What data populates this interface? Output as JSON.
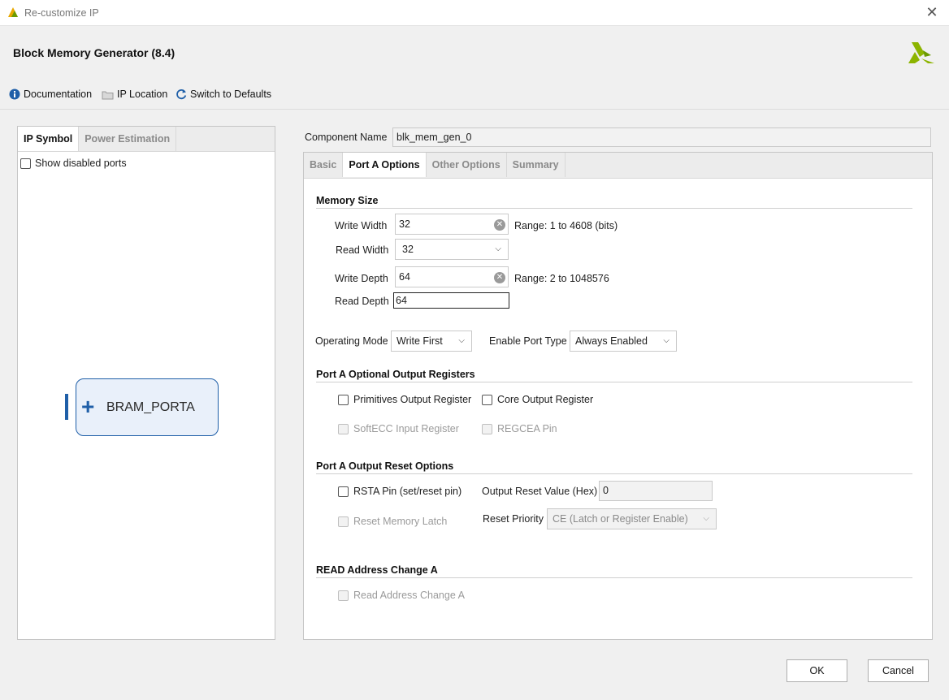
{
  "window": {
    "title": "Re-customize IP"
  },
  "header": {
    "title": "Block Memory Generator (8.4)"
  },
  "toolbar": {
    "documentation": "Documentation",
    "ip_location": "IP Location",
    "switch_defaults": "Switch to Defaults"
  },
  "left_panel": {
    "tabs": [
      "IP Symbol",
      "Power Estimation"
    ],
    "show_disabled_ports": "Show disabled ports",
    "port_label": "BRAM_PORTA"
  },
  "component": {
    "label": "Component Name",
    "value": "blk_mem_gen_0"
  },
  "tabs": [
    "Basic",
    "Port A Options",
    "Other Options",
    "Summary"
  ],
  "memory_size": {
    "title": "Memory Size",
    "write_width_label": "Write Width",
    "write_width": "32",
    "write_width_range": "Range: 1 to 4608 (bits)",
    "read_width_label": "Read Width",
    "read_width": "32",
    "write_depth_label": "Write Depth",
    "write_depth": "64",
    "write_depth_range": "Range: 2 to 1048576",
    "read_depth_label": "Read Depth",
    "read_depth": "64"
  },
  "operating_mode": {
    "label": "Operating Mode",
    "value": "Write First"
  },
  "enable_port": {
    "label": "Enable Port Type",
    "value": "Always Enabled"
  },
  "output_registers": {
    "title": "Port A Optional Output Registers",
    "primitives": "Primitives Output Register",
    "core": "Core Output Register",
    "softecc": "SoftECC Input Register",
    "regcea": "REGCEA Pin"
  },
  "reset_options": {
    "title": "Port A Output Reset Options",
    "rsta": "RSTA Pin (set/reset pin)",
    "output_reset_label": "Output Reset Value (Hex)",
    "output_reset_value": "0",
    "reset_memory_latch": "Reset Memory Latch",
    "reset_priority_label": "Reset Priority",
    "reset_priority_value": "CE (Latch or Register Enable)"
  },
  "read_address": {
    "title": "READ Address Change A",
    "option": "Read Address Change A"
  },
  "buttons": {
    "ok": "OK",
    "cancel": "Cancel"
  },
  "colors": {
    "accent_blue": "#1f5fa8",
    "logo_green": "#8cb400"
  }
}
